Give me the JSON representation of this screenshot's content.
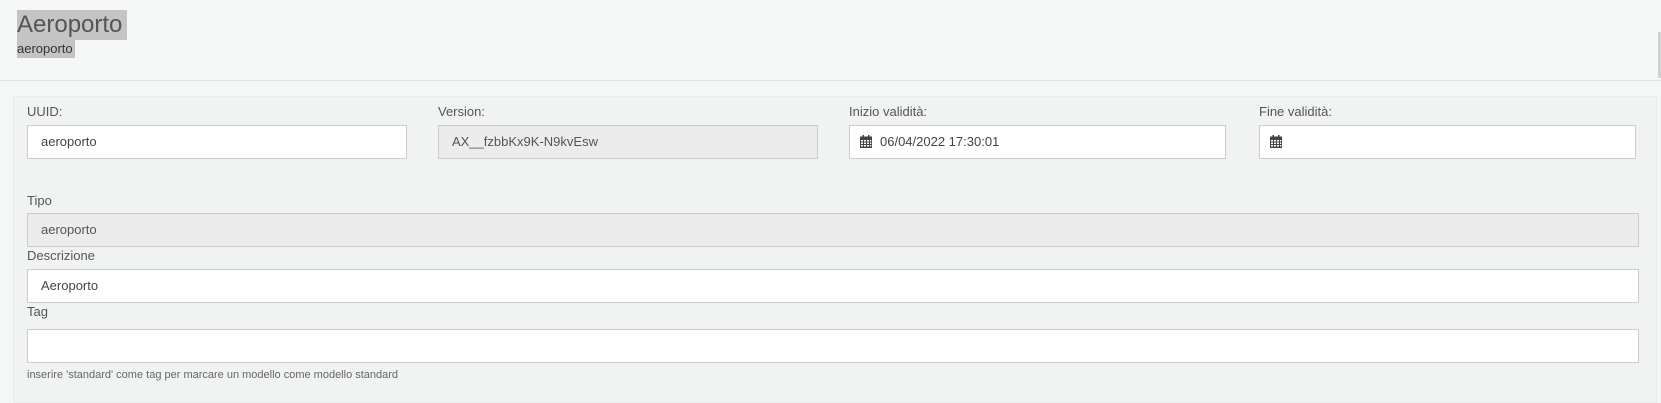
{
  "header": {
    "title": "Aeroporto",
    "subtitle": "aeroporto"
  },
  "form": {
    "uuid": {
      "label": "UUID:",
      "value": "aeroporto"
    },
    "version": {
      "label": "Version:",
      "value": "AX__fzbbKx9K-N9kvEsw"
    },
    "inizio_validita": {
      "label": "Inizio validità:",
      "value": "06/04/2022 17:30:01"
    },
    "fine_validita": {
      "label": "Fine validità:",
      "value": ""
    },
    "tipo": {
      "label": "Tipo",
      "value": "aeroporto"
    },
    "descrizione": {
      "label": "Descrizione",
      "value": "Aeroporto"
    },
    "tag": {
      "label": "Tag",
      "value": "",
      "help": "inserire 'standard' come tag per marcare un modello come modello standard"
    }
  },
  "icons": {
    "calendar": "calendar-icon"
  }
}
